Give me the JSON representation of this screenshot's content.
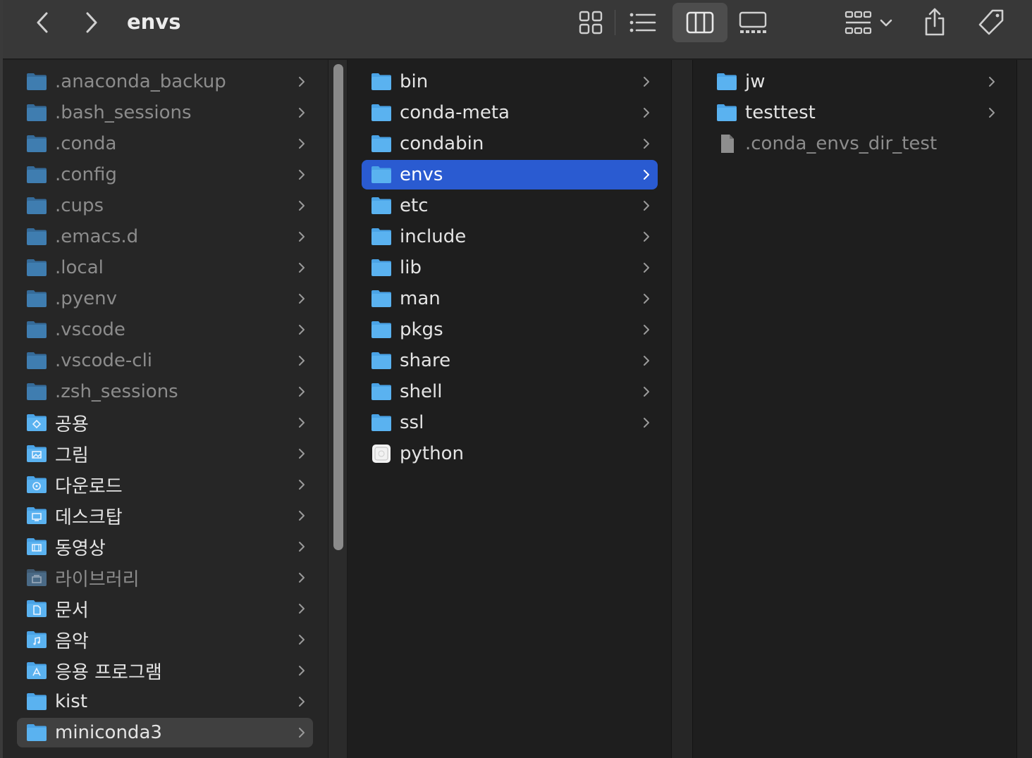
{
  "window": {
    "title": "envs"
  },
  "toolbar": {
    "back": "chevron-left-icon",
    "forward": "chevron-right-icon",
    "views": [
      "icon-view",
      "list-view",
      "column-view",
      "gallery-view"
    ],
    "selected_view": "column-view",
    "group": "group-by-icon",
    "share": "share-icon",
    "tag": "tag-icon"
  },
  "colors": {
    "selection_blue": "#2a5bd1",
    "folder_blue": "#5ab2f0",
    "hidden_folder": "#3f7db0",
    "toolbar_bg": "#383838"
  },
  "column1": {
    "items": [
      {
        "label": ".anaconda_backup",
        "kind": "hidden-folder",
        "dim": true
      },
      {
        "label": ".bash_sessions",
        "kind": "hidden-folder",
        "dim": true
      },
      {
        "label": ".conda",
        "kind": "hidden-folder",
        "dim": true
      },
      {
        "label": ".config",
        "kind": "hidden-folder",
        "dim": true
      },
      {
        "label": ".cups",
        "kind": "hidden-folder",
        "dim": true
      },
      {
        "label": ".emacs.d",
        "kind": "hidden-folder",
        "dim": true
      },
      {
        "label": ".local",
        "kind": "hidden-folder",
        "dim": true
      },
      {
        "label": ".pyenv",
        "kind": "hidden-folder",
        "dim": true
      },
      {
        "label": ".vscode",
        "kind": "hidden-folder",
        "dim": true
      },
      {
        "label": ".vscode-cli",
        "kind": "hidden-folder",
        "dim": true
      },
      {
        "label": ".zsh_sessions",
        "kind": "hidden-folder",
        "dim": true
      },
      {
        "label": "공용",
        "kind": "public-folder",
        "dim": false
      },
      {
        "label": "그림",
        "kind": "pictures-folder",
        "dim": false
      },
      {
        "label": "다운로드",
        "kind": "downloads-folder",
        "dim": false
      },
      {
        "label": "데스크탑",
        "kind": "desktop-folder",
        "dim": false
      },
      {
        "label": "동영상",
        "kind": "movies-folder",
        "dim": false
      },
      {
        "label": "라이브러리",
        "kind": "library-folder",
        "dim": true
      },
      {
        "label": "문서",
        "kind": "documents-folder",
        "dim": false
      },
      {
        "label": "음악",
        "kind": "music-folder",
        "dim": false
      },
      {
        "label": "응용 프로그램",
        "kind": "applications-folder",
        "dim": false
      },
      {
        "label": "kist",
        "kind": "folder",
        "dim": false
      },
      {
        "label": "miniconda3",
        "kind": "folder",
        "dim": false,
        "selected": "inactive"
      }
    ]
  },
  "column2": {
    "items": [
      {
        "label": "bin",
        "kind": "folder"
      },
      {
        "label": "conda-meta",
        "kind": "folder"
      },
      {
        "label": "condabin",
        "kind": "folder"
      },
      {
        "label": "envs",
        "kind": "folder",
        "selected": "active"
      },
      {
        "label": "etc",
        "kind": "folder"
      },
      {
        "label": "include",
        "kind": "folder"
      },
      {
        "label": "lib",
        "kind": "folder"
      },
      {
        "label": "man",
        "kind": "folder"
      },
      {
        "label": "pkgs",
        "kind": "folder"
      },
      {
        "label": "share",
        "kind": "folder"
      },
      {
        "label": "shell",
        "kind": "folder"
      },
      {
        "label": "ssl",
        "kind": "folder"
      },
      {
        "label": "python",
        "kind": "executable"
      }
    ]
  },
  "column3": {
    "items": [
      {
        "label": "jw",
        "kind": "folder"
      },
      {
        "label": "testtest",
        "kind": "folder"
      },
      {
        "label": ".conda_envs_dir_test",
        "kind": "hidden-file",
        "dim": true
      }
    ]
  }
}
